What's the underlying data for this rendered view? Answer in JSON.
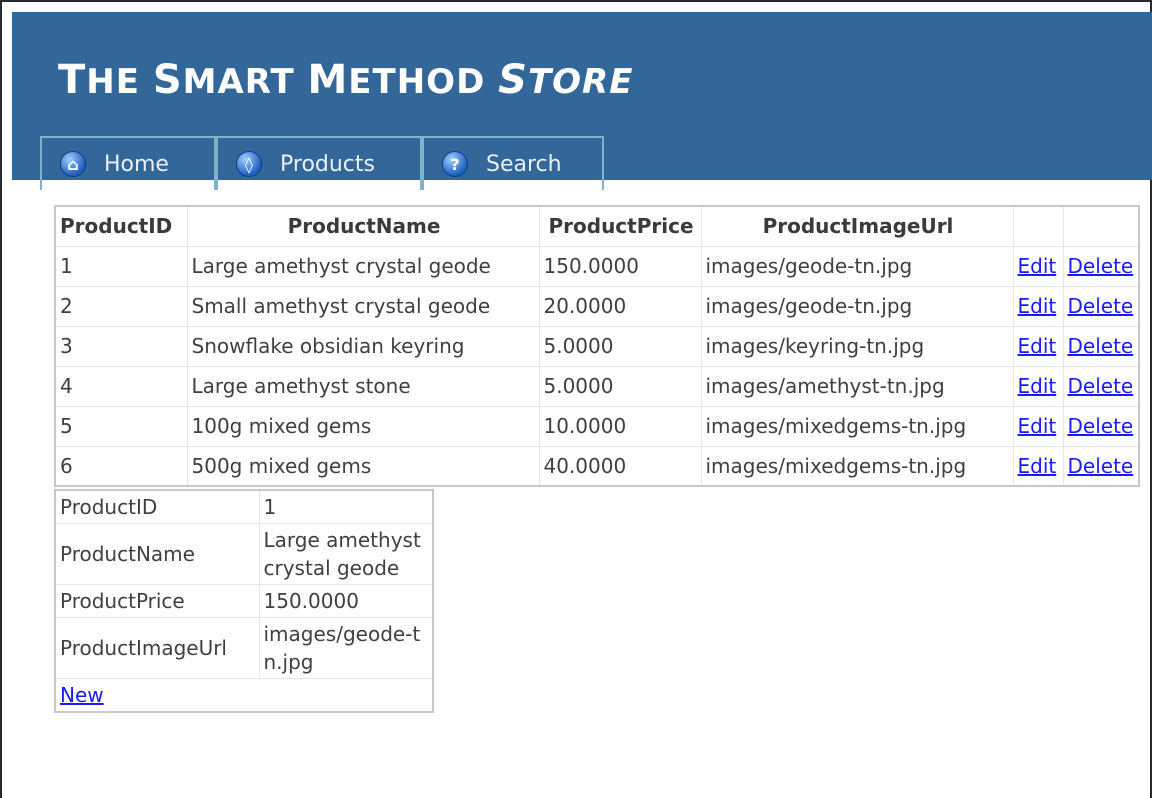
{
  "header": {
    "title_parts": [
      "T",
      "HE ",
      "S",
      "MART ",
      "M",
      "ETHOD ",
      "S",
      "TORE"
    ]
  },
  "nav": {
    "items": [
      {
        "label": "Home",
        "icon": "home-icon"
      },
      {
        "label": "Products",
        "icon": "products-icon"
      },
      {
        "label": "Search",
        "icon": "search-icon"
      }
    ]
  },
  "grid": {
    "headers": [
      "ProductID",
      "ProductName",
      "ProductPrice",
      "ProductImageUrl",
      "",
      ""
    ],
    "edit_label": "Edit",
    "delete_label": "Delete",
    "rows": [
      [
        "1",
        "Large amethyst crystal geode",
        "150.0000",
        "images/geode-tn.jpg"
      ],
      [
        "2",
        "Small amethyst crystal geode",
        "20.0000",
        "images/geode-tn.jpg"
      ],
      [
        "3",
        "Snowflake obsidian keyring",
        "5.0000",
        "images/keyring-tn.jpg"
      ],
      [
        "4",
        "Large amethyst stone",
        "5.0000",
        "images/amethyst-tn.jpg"
      ],
      [
        "5",
        "100g mixed gems",
        "10.0000",
        "images/mixedgems-tn.jpg"
      ],
      [
        "6",
        "500g mixed gems",
        "40.0000",
        "images/mixedgems-tn.jpg"
      ]
    ]
  },
  "details": {
    "fields": [
      {
        "label": "ProductID",
        "value": "1"
      },
      {
        "label": "ProductName",
        "value": "Large amethyst crystal geode"
      },
      {
        "label": "ProductPrice",
        "value": "150.0000"
      },
      {
        "label": "ProductImageUrl",
        "value": "images/geode-tn.jpg"
      }
    ],
    "new_label": "New"
  },
  "colors": {
    "banner": "#336699",
    "link": "#1a1aff",
    "tab_border": "#7fb3c7"
  }
}
